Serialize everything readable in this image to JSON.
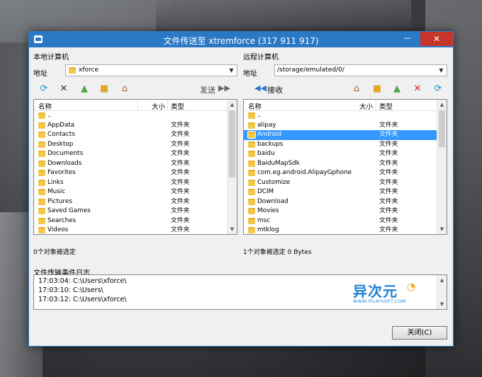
{
  "window": {
    "title": "文件传送至 xtremforce (317 911 917)",
    "minimize_glyph": "—",
    "close_glyph": "✕",
    "accent": "#2b78c5",
    "close_color": "#c7352a"
  },
  "local": {
    "section_label": "本地计算机",
    "address_label": "地址",
    "address_value": "xforce",
    "send_label": "发送",
    "columns": {
      "name": "名称",
      "size": "大小",
      "type": "类型"
    },
    "rows": [
      {
        "name": "..",
        "type": ""
      },
      {
        "name": "AppData",
        "type": "文件夹"
      },
      {
        "name": "Contacts",
        "type": "文件夹"
      },
      {
        "name": "Desktop",
        "type": "文件夹"
      },
      {
        "name": "Documents",
        "type": "文件夹"
      },
      {
        "name": "Downloads",
        "type": "文件夹"
      },
      {
        "name": "Favorites",
        "type": "文件夹"
      },
      {
        "name": "Links",
        "type": "文件夹"
      },
      {
        "name": "Music",
        "type": "文件夹"
      },
      {
        "name": "Pictures",
        "type": "文件夹"
      },
      {
        "name": "Saved Games",
        "type": "文件夹"
      },
      {
        "name": "Searches",
        "type": "文件夹"
      },
      {
        "name": "Videos",
        "type": "文件夹"
      }
    ],
    "status": "0个对象被选定"
  },
  "remote": {
    "section_label": "远程计算机",
    "address_label": "地址",
    "address_value": "/storage/emulated/0/",
    "receive_label": "接收",
    "columns": {
      "name": "名称",
      "size": "大小",
      "type": "类型"
    },
    "rows": [
      {
        "name": "..",
        "type": ""
      },
      {
        "name": "alipay",
        "type": "文件夹"
      },
      {
        "name": "Android",
        "type": "文件夹",
        "selected": true
      },
      {
        "name": "backups",
        "type": "文件夹"
      },
      {
        "name": "baidu",
        "type": "文件夹"
      },
      {
        "name": "BaiduMapSdk",
        "type": "文件夹"
      },
      {
        "name": "com.eg.android.AlipayGphone",
        "type": "文件夹"
      },
      {
        "name": "Customize",
        "type": "文件夹"
      },
      {
        "name": "DCIM",
        "type": "文件夹"
      },
      {
        "name": "Download",
        "type": "文件夹"
      },
      {
        "name": "Movies",
        "type": "文件夹"
      },
      {
        "name": "msc",
        "type": "文件夹"
      },
      {
        "name": "mtklog",
        "type": "文件夹"
      }
    ],
    "status": "1个对象被选定 0 Bytes"
  },
  "log": {
    "label": "文件传输事件日志",
    "lines": [
      "17:03:04: C:\\Users\\xforce\\",
      "17:03:10: C:\\Users\\",
      "17:03:12: C:\\Users\\xforce\\"
    ]
  },
  "watermark": {
    "main": "异次元",
    "sub": "WWW.IPLAYSOFT.COM"
  },
  "close_button_label": "关闭(C)",
  "icons": {
    "refresh": "refresh-icon",
    "delete": "delete-icon",
    "up_folder": "parent-folder-icon",
    "new_folder": "new-folder-icon",
    "home": "home-icon"
  }
}
